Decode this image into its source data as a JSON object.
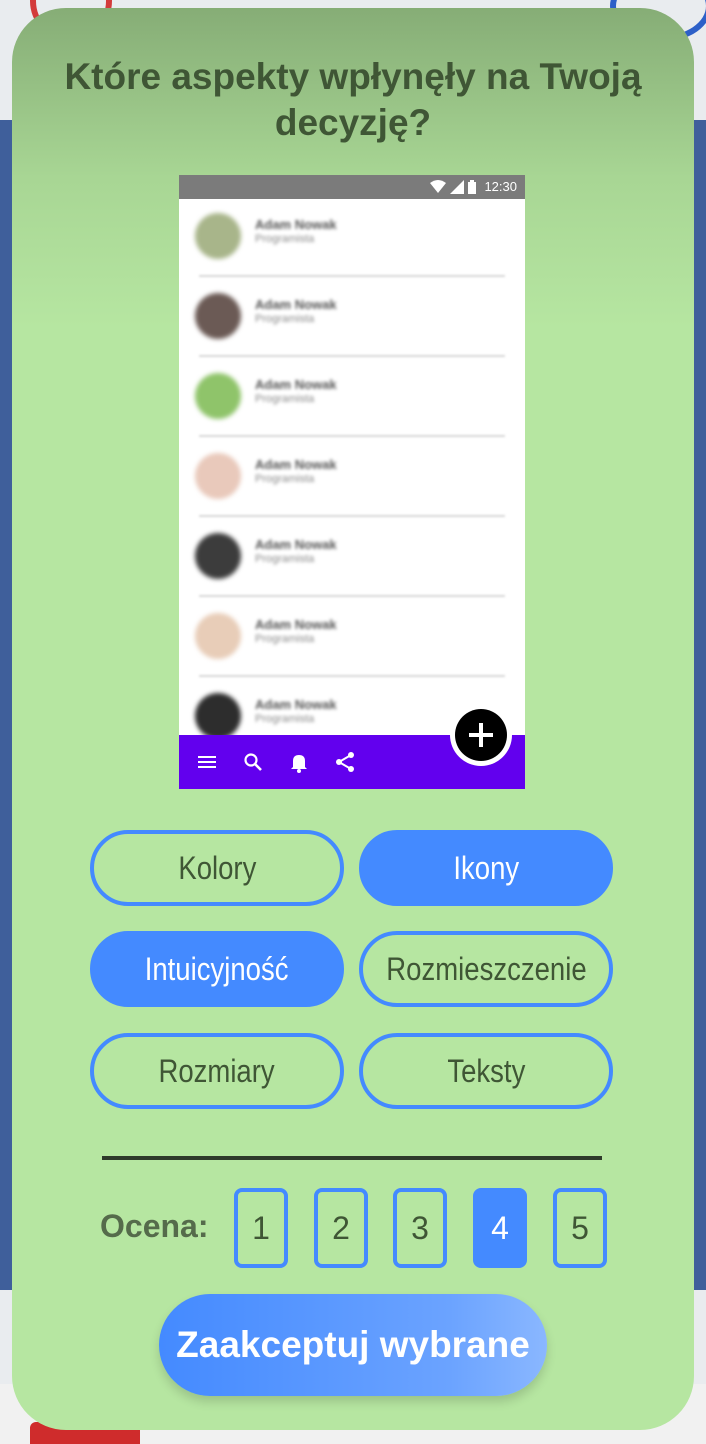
{
  "dialog": {
    "title_line1": "Które aspekty wpłynęły na Twoją",
    "title_line2": "decyzję?"
  },
  "preview": {
    "status_time": "12:30",
    "contacts": [
      {
        "name": "Adam Nowak",
        "sub": "Programista",
        "avatar_color": "#a8b58a"
      },
      {
        "name": "Adam Nowak",
        "sub": "Programista",
        "avatar_color": "#6b5a55"
      },
      {
        "name": "Adam Nowak",
        "sub": "Programista",
        "avatar_color": "#8fc46a"
      },
      {
        "name": "Adam Nowak",
        "sub": "Programista",
        "avatar_color": "#e9c9bb"
      },
      {
        "name": "Adam Nowak",
        "sub": "Programista",
        "avatar_color": "#3c3c3c"
      },
      {
        "name": "Adam Nowak",
        "sub": "Programista",
        "avatar_color": "#e8cdb8"
      },
      {
        "name": "Adam Nowak",
        "sub": "Programista",
        "avatar_color": "#2d2d2d"
      }
    ],
    "bottom_bar_color": "#6200ee",
    "bottom_icons": [
      "menu-icon",
      "search-icon",
      "bell-icon",
      "share-icon"
    ],
    "fab_icon": "plus-icon"
  },
  "choices": [
    {
      "label": "Kolory",
      "selected": false
    },
    {
      "label": "Ikony",
      "selected": true
    },
    {
      "label": "Intuicyjność",
      "selected": true
    },
    {
      "label": "Rozmieszczenie",
      "selected": false
    },
    {
      "label": "Rozmiary",
      "selected": false
    },
    {
      "label": "Teksty",
      "selected": false
    }
  ],
  "rating": {
    "label": "Ocena:",
    "options": [
      "1",
      "2",
      "3",
      "4",
      "5"
    ],
    "selected": "4"
  },
  "accept_label": "Zaakceptuj wybrane",
  "colors": {
    "accent": "#448aff",
    "dialog_bg": "#b6e6a1",
    "title_text": "#3f5635"
  }
}
